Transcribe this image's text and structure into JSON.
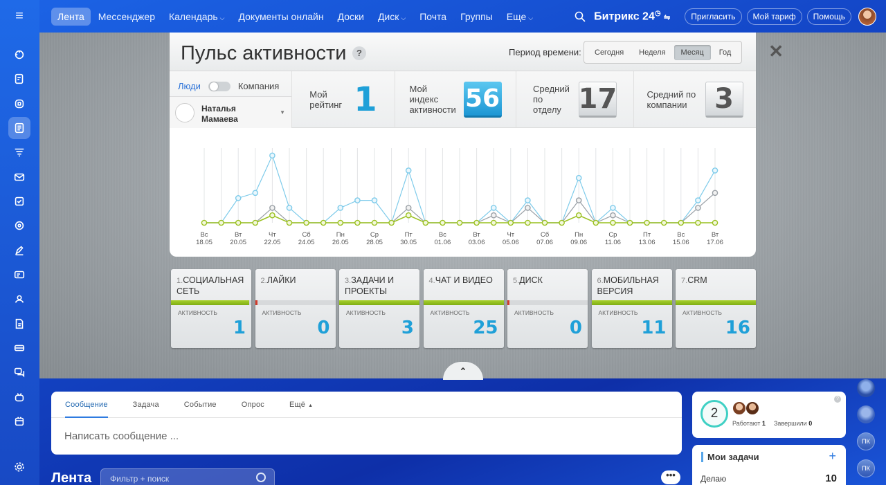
{
  "topbar": {
    "nav": [
      {
        "label": "Лента",
        "active": true
      },
      {
        "label": "Мессенджер"
      },
      {
        "label": "Календарь",
        "dropdown": true
      },
      {
        "label": "Документы онлайн"
      },
      {
        "label": "Доски"
      },
      {
        "label": "Диск",
        "dropdown": true
      },
      {
        "label": "Почта"
      },
      {
        "label": "Группы"
      },
      {
        "label": "Еще",
        "dropdown": true
      }
    ],
    "brand": "Битрикс 24",
    "invite": "Пригласить",
    "plan": "Мой тариф",
    "help": "Помощь"
  },
  "pulse": {
    "title": "Пульс активности",
    "help": "?",
    "period_label": "Период времени:",
    "periods": [
      {
        "label": "Сегодня"
      },
      {
        "label": "Неделя"
      },
      {
        "label": "Месяц",
        "active": true
      },
      {
        "label": "Год"
      }
    ],
    "toggle_people": "Люди",
    "toggle_company": "Компания",
    "user_name": "Наталья Мамаева",
    "my_rating_label": "Мой рейтинг",
    "my_rating": "1",
    "my_index_label": "Мой индекс активности",
    "my_index": "56",
    "dept_label": "Средний по отделу",
    "dept_avg": "17",
    "company_label": "Средний по компании",
    "company_avg": "3"
  },
  "chart_data": {
    "type": "line",
    "x": [
      "18.05",
      "19.05",
      "20.05",
      "21.05",
      "22.05",
      "23.05",
      "24.05",
      "25.05",
      "26.05",
      "27.05",
      "28.05",
      "29.05",
      "30.05",
      "31.05",
      "01.06",
      "02.06",
      "03.06",
      "04.06",
      "05.06",
      "06.06",
      "07.06",
      "08.06",
      "09.06",
      "10.06",
      "11.06",
      "12.06",
      "13.06",
      "14.06",
      "15.06",
      "16.06",
      "17.06"
    ],
    "tick_labels": [
      {
        "day": "Вс",
        "date": "18.05"
      },
      {
        "day": "Вт",
        "date": "20.05"
      },
      {
        "day": "Чт",
        "date": "22.05"
      },
      {
        "day": "Сб",
        "date": "24.05"
      },
      {
        "day": "Пн",
        "date": "26.05"
      },
      {
        "day": "Ср",
        "date": "28.05"
      },
      {
        "day": "Пт",
        "date": "30.05"
      },
      {
        "day": "Вс",
        "date": "01.06"
      },
      {
        "day": "Вт",
        "date": "03.06"
      },
      {
        "day": "Чт",
        "date": "05.06"
      },
      {
        "day": "Сб",
        "date": "07.06"
      },
      {
        "day": "Пн",
        "date": "09.06"
      },
      {
        "day": "Ср",
        "date": "11.06"
      },
      {
        "day": "Пт",
        "date": "13.06"
      },
      {
        "day": "Вс",
        "date": "15.06"
      },
      {
        "day": "Вт",
        "date": "17.06"
      }
    ],
    "series": [
      {
        "color": "#7ecbea",
        "values": [
          0,
          0,
          3.3,
          4,
          9,
          2,
          0,
          0,
          2,
          3,
          3,
          0,
          7,
          0,
          0,
          0,
          0,
          2,
          0,
          3,
          0,
          0,
          6,
          0,
          2,
          0,
          0,
          0,
          0,
          3,
          7
        ]
      },
      {
        "color": "#9aa0a6",
        "values": [
          0,
          0,
          0,
          0,
          2,
          0,
          0,
          0,
          0,
          0,
          0,
          0,
          2,
          0,
          0,
          0,
          0,
          1,
          0,
          2,
          0,
          0,
          3,
          0,
          1,
          0,
          0,
          0,
          0,
          2,
          4
        ]
      },
      {
        "color": "#99c01e",
        "values": [
          0,
          0,
          0,
          0,
          1,
          0,
          0,
          0,
          0,
          0,
          0,
          0,
          1,
          0,
          0,
          0,
          0,
          0,
          0,
          0,
          0,
          0,
          1,
          0,
          0,
          0,
          0,
          0,
          0,
          0,
          0
        ]
      }
    ],
    "ylim": [
      0,
      10
    ],
    "grid": true
  },
  "cards": [
    {
      "num": "1.",
      "label": "Социальная сеть",
      "value": "1",
      "fill": 0.97
    },
    {
      "num": "2.",
      "label": "Лайки",
      "value": "0",
      "fill": 0
    },
    {
      "num": "3.",
      "label": "Задачи и проекты",
      "value": "3",
      "fill": 1
    },
    {
      "num": "4.",
      "label": "Чат и видео",
      "value": "25",
      "fill": 1
    },
    {
      "num": "5.",
      "label": "Диск",
      "value": "0",
      "fill": 0
    },
    {
      "num": "6.",
      "label": "Мобильная версия",
      "value": "11",
      "fill": 1
    },
    {
      "num": "7.",
      "label": "CRM",
      "value": "16",
      "fill": 1
    }
  ],
  "card_activity_label": "Активность",
  "composer": {
    "tabs": [
      {
        "label": "Сообщение",
        "active": true
      },
      {
        "label": "Задача"
      },
      {
        "label": "Событие"
      },
      {
        "label": "Опрос"
      },
      {
        "label": "Ещё",
        "dropdown": true
      }
    ],
    "placeholder": "Написать сообщение ..."
  },
  "feed": {
    "title": "Лента",
    "filter_placeholder": "Фильтр + поиск",
    "more": "•••"
  },
  "workday": {
    "count": "2",
    "working_label": "Работают",
    "working": "1",
    "finished_label": "Завершили",
    "finished": "0"
  },
  "tasks": {
    "title": "Мои задачи",
    "row_label": "Делаю",
    "row_value": "10"
  },
  "rail": {
    "initials": "ПК"
  }
}
